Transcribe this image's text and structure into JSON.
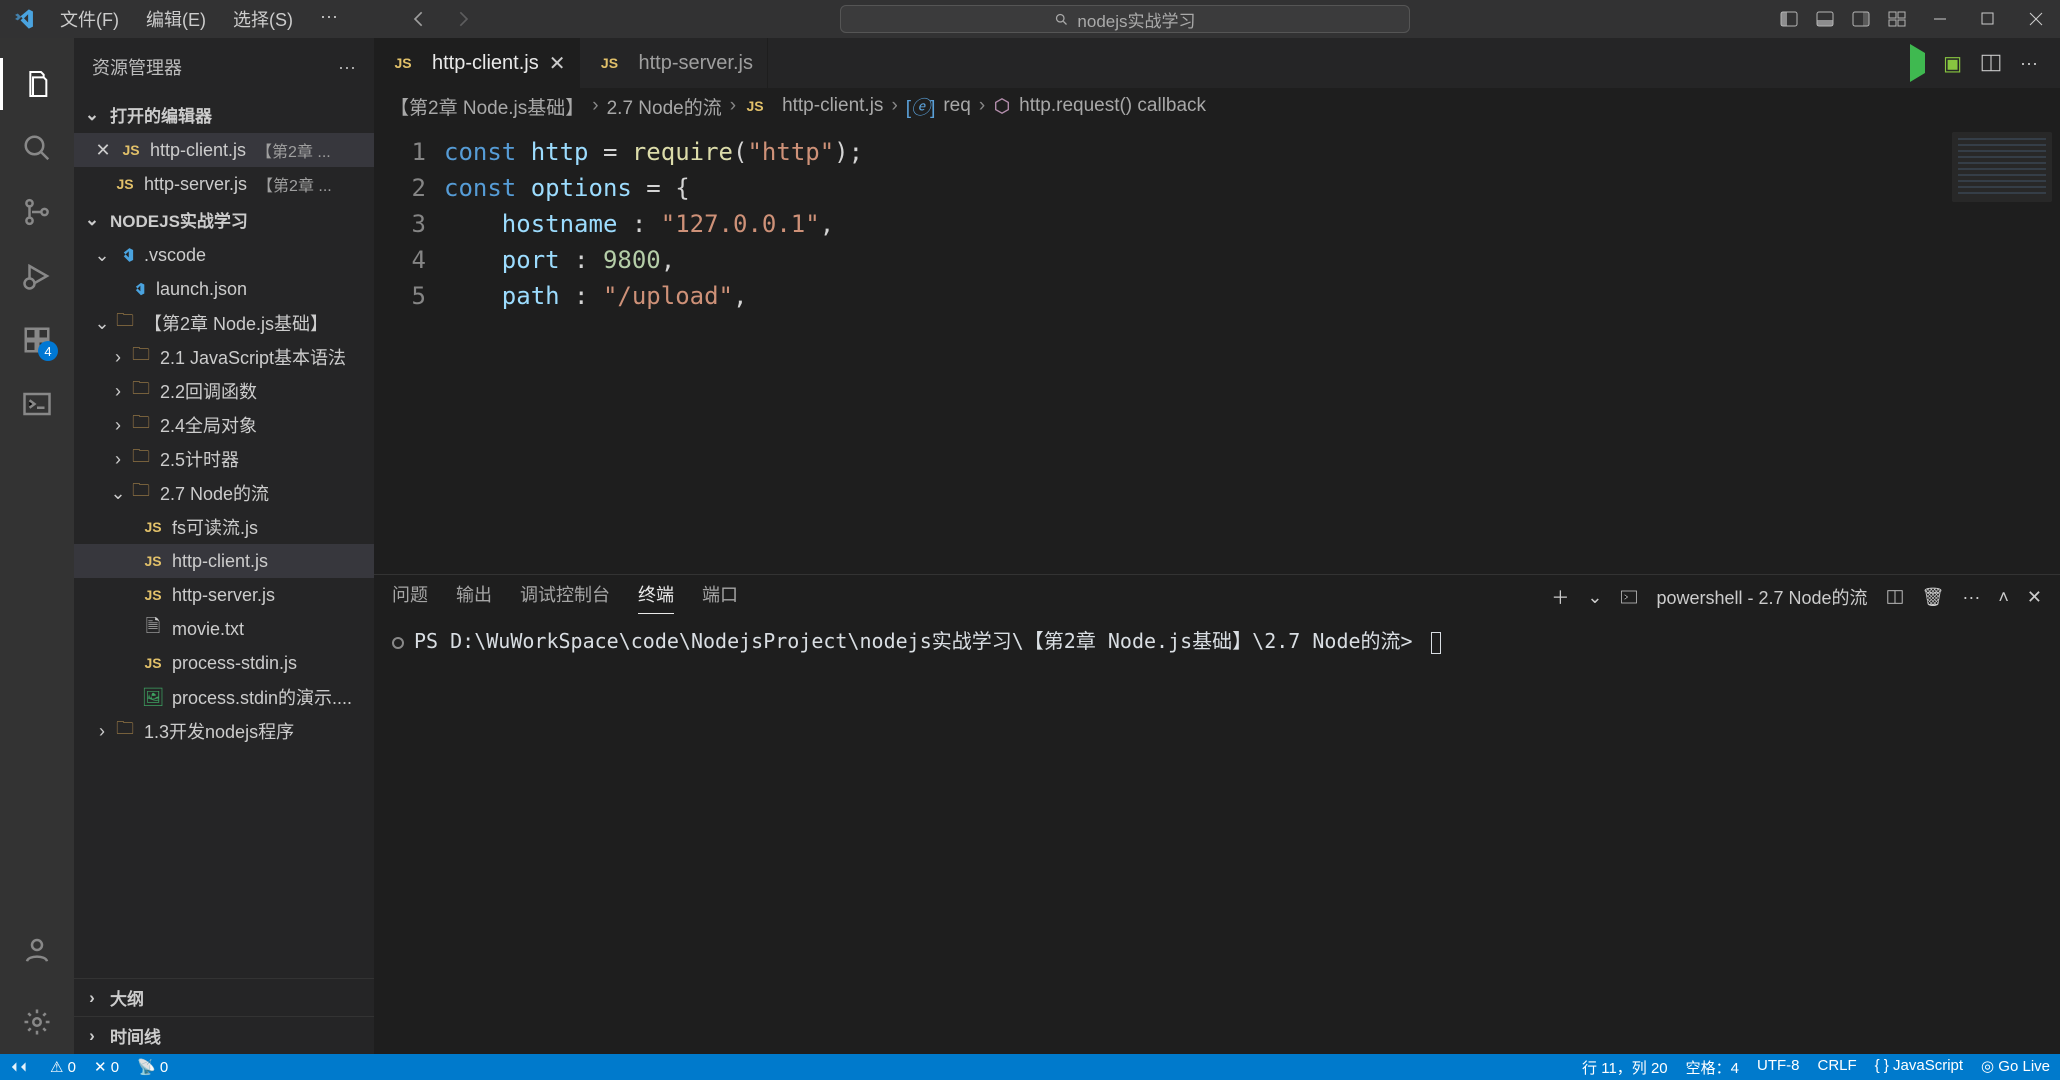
{
  "title_menu": [
    "文件(F)",
    "编辑(E)",
    "选择(S)",
    "···"
  ],
  "search_placeholder": "nodejs实战学习",
  "activity_badge": "4",
  "sidebar_title": "资源管理器",
  "open_editors_header": "打开的编辑器",
  "open_editors": [
    {
      "name": "http-client.js",
      "hint": "【第2章 ...",
      "active": true
    },
    {
      "name": "http-server.js",
      "hint": "【第2章 ...",
      "active": false
    }
  ],
  "workspace_header": "NODEJS实战学习",
  "tree": {
    "vscode": ".vscode",
    "launch": "launch.json",
    "chapter2": "【第2章  Node.js基础】",
    "d1": "2.1  JavaScript基本语法",
    "d2": "2.2回调函数",
    "d3": "2.4全局对象",
    "d4": "2.5计时器",
    "d5": "2.7 Node的流",
    "f1": "fs可读流.js",
    "f2": "http-client.js",
    "f3": "http-server.js",
    "f4": "movie.txt",
    "f5": "process-stdin.js",
    "f6": "process.stdin的演示....",
    "d6": "1.3开发nodejs程序"
  },
  "sidebar_sections": {
    "outline": "大纲",
    "timeline": "时间线"
  },
  "tabs": [
    {
      "label": "http-client.js",
      "active": true,
      "closable": true
    },
    {
      "label": "http-server.js",
      "active": false,
      "closable": false
    }
  ],
  "breadcrumb": [
    "【第2章  Node.js基础】",
    "2.7 Node的流",
    "http-client.js",
    "req",
    "http.request() callback"
  ],
  "code_lines": [
    "1",
    "2",
    "3",
    "4",
    "5"
  ],
  "code": {
    "l1a": "const ",
    "l1b": "http",
    "l1c": " = ",
    "l1d": "require",
    "l1e": "(",
    "l1f": "\"http\"",
    "l1g": ");",
    "l2a": "const ",
    "l2b": "options",
    "l2c": " = {",
    "l3a": "    hostname ",
    "l3b": ": ",
    "l3c": "\"127.0.0.1\"",
    "l3d": ",",
    "l4a": "    port ",
    "l4b": ": ",
    "l4c": "9800",
    "l4d": ",",
    "l5a": "    path ",
    "l5b": ": ",
    "l5c": "\"/upload\"",
    "l5d": ","
  },
  "panel_tabs": [
    "问题",
    "输出",
    "调试控制台",
    "终端",
    "端口"
  ],
  "panel_active": "终端",
  "terminal_shell_label": "powershell - 2.7 Node的流",
  "terminal_prompt": "PS  D:\\WuWorkSpace\\code\\NodejsProject\\nodejs实战学习\\【第2章  Node.js基础】\\2.7 Node的流> ",
  "status": {
    "left": [
      "⚠ 0",
      "✕ 0",
      "📡 0"
    ],
    "right": [
      "行 11，列 20",
      "空格：4",
      "UTF-8",
      "CRLF",
      "{ } JavaScript",
      "◎ Go Live"
    ]
  }
}
